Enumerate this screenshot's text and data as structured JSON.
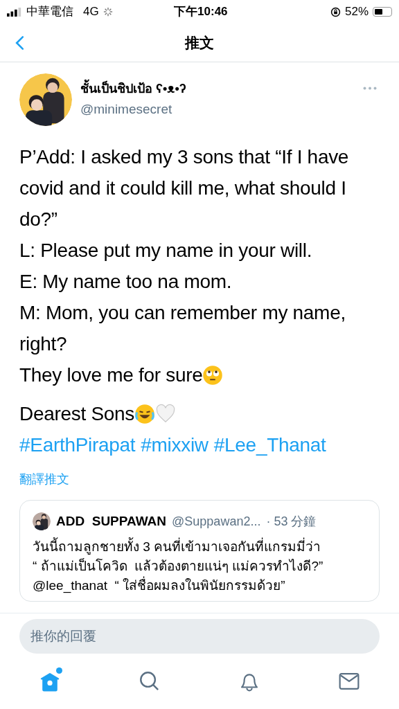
{
  "status_bar": {
    "carrier": "中華電信",
    "network": "4G",
    "time": "下午10:46",
    "battery": "52%"
  },
  "nav": {
    "title": "推文"
  },
  "tweet": {
    "display_name": "ชั้นเป็นชิปเป้อ ʕ•ᴥ•ʔ",
    "handle": "@minimesecret",
    "paragraphs": [
      {
        "kind": "text",
        "text": "P’Add: I asked my 3 sons that “If I have covid and it could kill me, what should I do?”"
      },
      {
        "kind": "text",
        "text": "L: Please put my name in your will."
      },
      {
        "kind": "text",
        "text": "E: My name too na mom."
      },
      {
        "kind": "text",
        "text": "M: Mom, you can remember my name, right?"
      },
      {
        "kind": "eyeroll",
        "text": "They love me for sure"
      },
      {
        "kind": "gap"
      },
      {
        "kind": "laugh",
        "text": "Dearest Sons"
      },
      {
        "kind": "hashtags",
        "tags": [
          "#EarthPirapat",
          "#mixxiw",
          "#Lee_Thanat"
        ]
      }
    ],
    "translate": "翻譯推文",
    "quote": {
      "name": "ADD  SUPPAWAN",
      "handle": "@Suppawan2...",
      "time": "· 53 分鐘",
      "lines": [
        "วันนี้ถามลูกชายทั้ง 3 คนที่เข้ามาเจอกันที่แกรมมี่ว่า",
        "“ ถ้าแม่เป็นโควิด  แล้วต้องตายแน่ๆ แม่ควรทำไงดี?”",
        "@lee_thanat  “ ใส่ชื่อผมลงในพินัยกรรมด้วย”"
      ]
    }
  },
  "reply": {
    "placeholder": "推你的回覆"
  },
  "tabs": [
    {
      "kind": "home",
      "selected": true,
      "badge": true
    },
    {
      "kind": "search",
      "selected": false,
      "badge": false
    },
    {
      "kind": "bell",
      "selected": false,
      "badge": false
    },
    {
      "kind": "mail",
      "selected": false,
      "badge": false
    }
  ]
}
